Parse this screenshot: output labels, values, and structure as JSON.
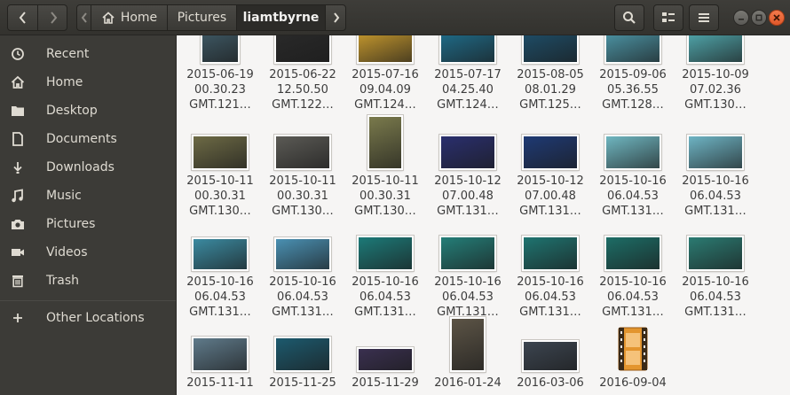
{
  "header": {
    "breadcrumbs": [
      {
        "label": "Home",
        "icon": "home-icon"
      },
      {
        "label": "Pictures"
      },
      {
        "label": "liamtbyrne"
      }
    ]
  },
  "sidebar": {
    "items": [
      {
        "label": "Recent",
        "icon": "clock-icon"
      },
      {
        "label": "Home",
        "icon": "home-icon"
      },
      {
        "label": "Desktop",
        "icon": "folder-icon"
      },
      {
        "label": "Documents",
        "icon": "document-icon"
      },
      {
        "label": "Downloads",
        "icon": "download-icon"
      },
      {
        "label": "Music",
        "icon": "music-icon"
      },
      {
        "label": "Pictures",
        "icon": "camera-icon"
      },
      {
        "label": "Videos",
        "icon": "video-icon"
      },
      {
        "label": "Trash",
        "icon": "trash-icon"
      },
      {
        "label": "Other Locations",
        "icon": "plus-icon"
      }
    ]
  },
  "files": [
    {
      "l1": "2015-06-19",
      "l2": "00.30.23",
      "l3": "GMT.121…",
      "color": "#3f5a66"
    },
    {
      "l1": "2015-06-22",
      "l2": "12.50.50",
      "l3": "GMT.122…",
      "color": "#2a2a2a"
    },
    {
      "l1": "2015-07-16",
      "l2": "09.04.09",
      "l3": "GMT.124…",
      "color": "#c99b2e"
    },
    {
      "l1": "2015-07-17",
      "l2": "04.25.40",
      "l3": "GMT.124…",
      "color": "#1f6e8c"
    },
    {
      "l1": "2015-08-05",
      "l2": "08.01.29",
      "l3": "GMT.125…",
      "color": "#1e4f6a"
    },
    {
      "l1": "2015-09-06",
      "l2": "05.36.55",
      "l3": "GMT.128…",
      "color": "#4d97a8"
    },
    {
      "l1": "2015-10-09",
      "l2": "07.02.36",
      "l3": "GMT.130…",
      "color": "#4fa3a8"
    },
    {
      "l1": "2015-10-11",
      "l2": "00.30.31",
      "l3": "GMT.130…",
      "color": "#6d6a45"
    },
    {
      "l1": "2015-10-11",
      "l2": "00.30.31",
      "l3": "GMT.130…",
      "color": "#5b5a55"
    },
    {
      "l1": "2015-10-11",
      "l2": "00.30.31",
      "l3": "GMT.130…",
      "color": "#7a7a4c"
    },
    {
      "l1": "2015-10-12",
      "l2": "07.00.48",
      "l3": "GMT.131…",
      "color": "#2a2f6e"
    },
    {
      "l1": "2015-10-12",
      "l2": "07.00.48",
      "l3": "GMT.131…",
      "color": "#1f3a74"
    },
    {
      "l1": "2015-10-16",
      "l2": "06.04.53",
      "l3": "GMT.131…",
      "color": "#6fb6c0"
    },
    {
      "l1": "2015-10-16",
      "l2": "06.04.53",
      "l3": "GMT.131…",
      "color": "#6eb4c4"
    },
    {
      "l1": "2015-10-16",
      "l2": "06.04.53",
      "l3": "GMT.131…",
      "color": "#3b8aa0"
    },
    {
      "l1": "2015-10-16",
      "l2": "06.04.53",
      "l3": "GMT.131…",
      "color": "#4a90b2"
    },
    {
      "l1": "2015-10-16",
      "l2": "06.04.53",
      "l3": "GMT.131…",
      "color": "#1c7a78"
    },
    {
      "l1": "2015-10-16",
      "l2": "06.04.53",
      "l3": "GMT.131…",
      "color": "#247e78"
    },
    {
      "l1": "2015-10-16",
      "l2": "06.04.53",
      "l3": "GMT.131…",
      "color": "#1f7470"
    },
    {
      "l1": "2015-10-16",
      "l2": "06.04.53",
      "l3": "GMT.131…",
      "color": "#1d6d66"
    },
    {
      "l1": "2015-10-16",
      "l2": "06.04.53",
      "l3": "GMT.131…",
      "color": "#2b7b72"
    },
    {
      "l1": "2015-11-11",
      "l2": "",
      "l3": "",
      "color": "#5f7a8a"
    },
    {
      "l1": "2015-11-25",
      "l2": "",
      "l3": "",
      "color": "#1c5a6e"
    },
    {
      "l1": "2015-11-29",
      "l2": "",
      "l3": "",
      "color": "#3a3050"
    },
    {
      "l1": "2016-01-24",
      "l2": "",
      "l3": "",
      "color": "#5c5446"
    },
    {
      "l1": "2016-03-06",
      "l2": "",
      "l3": "",
      "color": "#3c4550"
    },
    {
      "l1": "2016-09-04",
      "l2": "",
      "l3": "",
      "color": "#d98a2a"
    }
  ]
}
